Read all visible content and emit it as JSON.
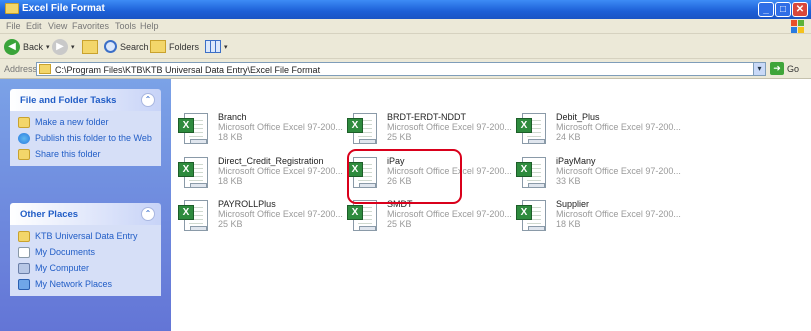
{
  "window": {
    "title": "Excel File Format",
    "controls": {
      "minimize": "_",
      "maximize": "□",
      "close": "✕"
    }
  },
  "menu": [
    "File",
    "Edit",
    "View",
    "Favorites",
    "Tools",
    "Help"
  ],
  "toolbar": {
    "back": "Back",
    "search": "Search",
    "folders": "Folders"
  },
  "address": {
    "label": "Address",
    "path": "C:\\Program Files\\KTB\\KTB Universal Data Entry\\Excel File Format",
    "go": "Go"
  },
  "tasks_panel": {
    "title": "File and Folder Tasks",
    "items": [
      {
        "label": "Make a new folder",
        "icon": "new-folder-icon"
      },
      {
        "label": "Publish this folder to the Web",
        "icon": "publish-web-icon"
      },
      {
        "label": "Share this folder",
        "icon": "share-folder-icon"
      }
    ]
  },
  "places_panel": {
    "title": "Other Places",
    "items": [
      {
        "label": "KTB Universal Data Entry",
        "icon": "folder-icon"
      },
      {
        "label": "My Documents",
        "icon": "my-documents-icon"
      },
      {
        "label": "My Computer",
        "icon": "my-computer-icon"
      },
      {
        "label": "My Network Places",
        "icon": "network-places-icon"
      }
    ]
  },
  "files": [
    {
      "name": "Branch",
      "type": "Microsoft Office Excel 97-200...",
      "size": "18 KB"
    },
    {
      "name": "BRDT-ERDT-NDDT",
      "type": "Microsoft Office Excel 97-200...",
      "size": "25 KB"
    },
    {
      "name": "Debit_Plus",
      "type": "Microsoft Office Excel 97-200...",
      "size": "24 KB"
    },
    {
      "name": "Direct_Credit_Registration",
      "type": "Microsoft Office Excel 97-200...",
      "size": "18 KB"
    },
    {
      "name": "iPay",
      "type": "Microsoft Office Excel 97-200...",
      "size": "26 KB"
    },
    {
      "name": "iPayMany",
      "type": "Microsoft Office Excel 97-200...",
      "size": "33 KB"
    },
    {
      "name": "PAYROLLPlus",
      "type": "Microsoft Office Excel 97-200...",
      "size": "25 KB"
    },
    {
      "name": "SMDT",
      "type": "Microsoft Office Excel 97-200...",
      "size": "25 KB"
    },
    {
      "name": "Supplier",
      "type": "Microsoft Office Excel 97-200...",
      "size": "18 KB"
    }
  ],
  "colors": {
    "highlight": "#d9001b",
    "titlebar": "#1c5fd6",
    "tasklink": "#215dc6"
  }
}
